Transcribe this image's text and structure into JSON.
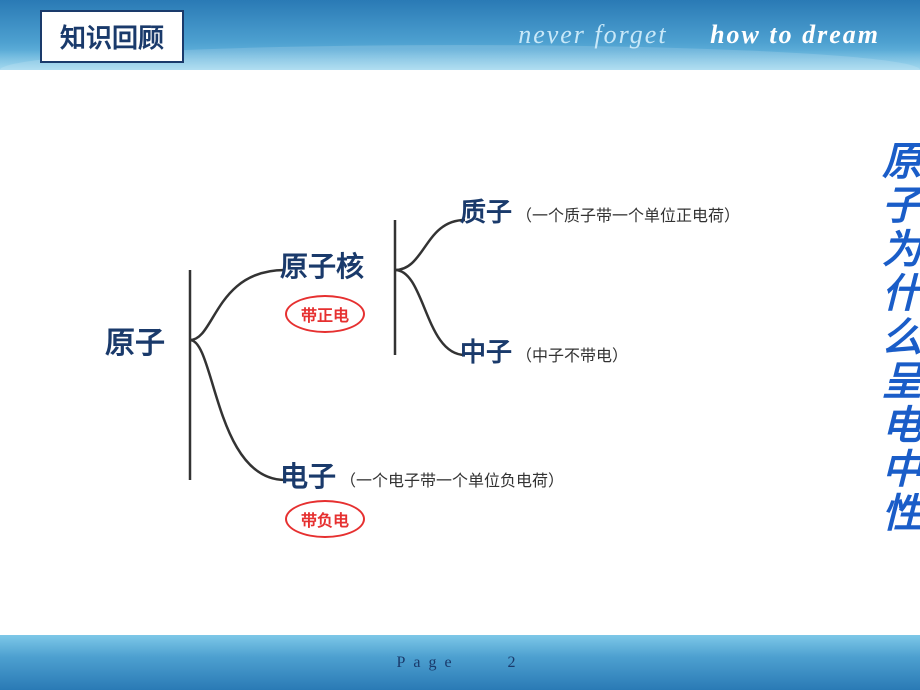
{
  "header": {
    "tagline_part1": "never forget",
    "tagline_part2": "how to dream",
    "title_box": "知识回顾"
  },
  "footer": {
    "page_label": "Page",
    "page_number": "2"
  },
  "mindmap": {
    "nodes": {
      "atom": "原子",
      "nucleus": "原子核",
      "nucleus_badge": "带正电",
      "proton": "质子",
      "proton_desc": "（一个质子带一个单位正电荷）",
      "neutron": "中子",
      "neutron_desc": "（中子不带电）",
      "electron": "电子",
      "electron_desc": "（一个电子带一个单位负电荷）",
      "electron_badge": "带负电"
    },
    "right_title": "原子为什么呈电中性"
  }
}
